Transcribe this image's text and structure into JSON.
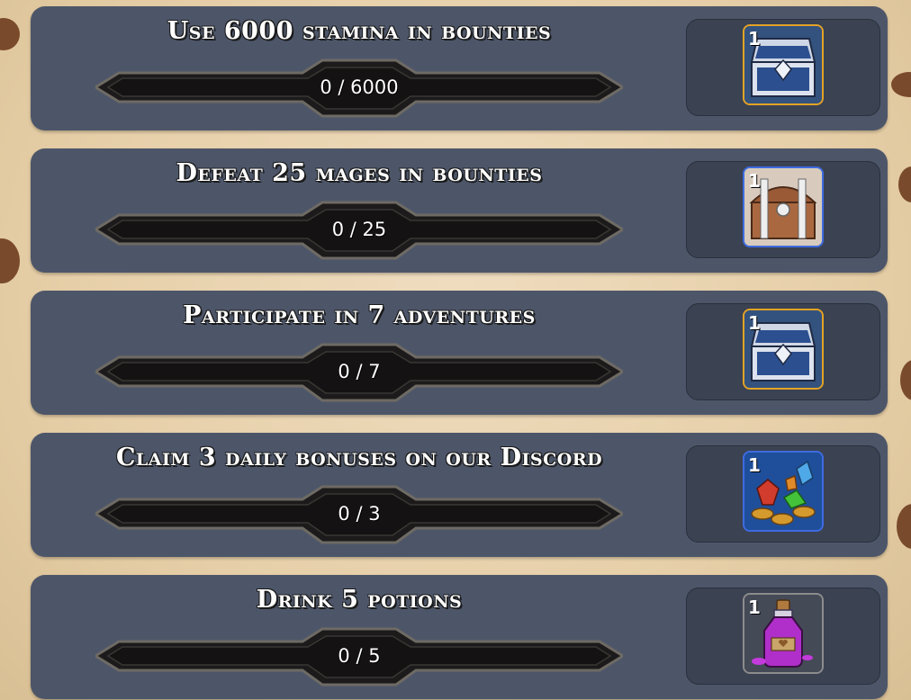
{
  "quests": [
    {
      "title": "Use 6000 stamina in bounties",
      "progress": "0 / 6000",
      "reward_count": "1",
      "reward_icon": "silver-chest-icon",
      "reward_border": "#e3a325"
    },
    {
      "title": "Defeat 25 mages in bounties",
      "progress": "0 / 25",
      "reward_count": "1",
      "reward_icon": "wooden-chest-icon",
      "reward_border": "#3e6be0"
    },
    {
      "title": "Participate in 7 adventures",
      "progress": "0 / 7",
      "reward_count": "1",
      "reward_icon": "silver-chest-icon",
      "reward_border": "#e3a325"
    },
    {
      "title": "Claim 3 daily bonuses on our Discord",
      "progress": "0 / 3",
      "reward_count": "1",
      "reward_icon": "gems-and-coins-icon",
      "reward_border": "#3e6be0"
    },
    {
      "title": "Drink 5 potions",
      "progress": "0 / 5",
      "reward_count": "1",
      "reward_icon": "purple-potion-icon",
      "reward_border": "#8c8c8c"
    }
  ],
  "colors": {
    "panel": "#4d5669",
    "reward_box": "#3b4252",
    "background": "#e6cfa8"
  }
}
